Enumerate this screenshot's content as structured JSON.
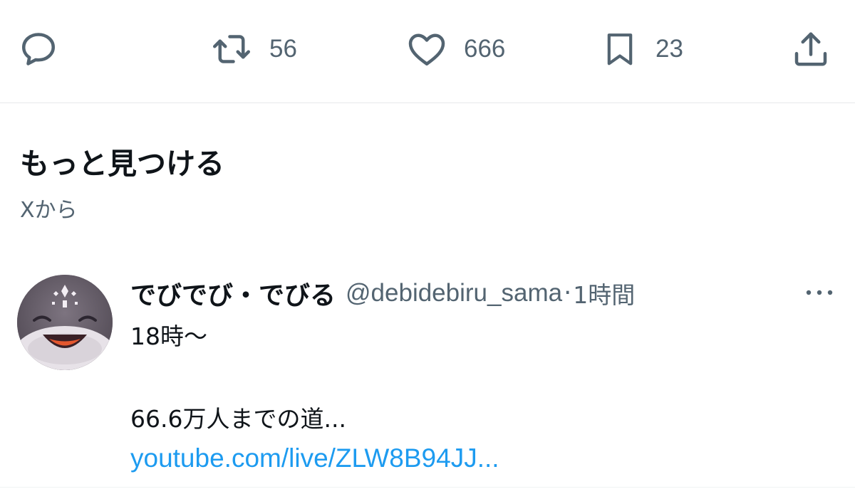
{
  "actions": {
    "reply": {
      "icon": "reply-icon"
    },
    "retweet": {
      "icon": "retweet-icon",
      "count": "56"
    },
    "like": {
      "icon": "heart-icon",
      "count": "666"
    },
    "bookmark": {
      "icon": "bookmark-icon",
      "count": "23"
    },
    "share": {
      "icon": "share-icon"
    }
  },
  "discover": {
    "title": "もっと見つける",
    "subtitle": "Xから"
  },
  "tweet": {
    "author_name": "でびでび・でびる",
    "handle": "@debidebiru_sama",
    "separator": "·",
    "time": "1時間",
    "lines": [
      "18時〜",
      "66.6万人までの道..."
    ],
    "link": "youtube.com/live/ZLW8B94JJ..."
  },
  "colors": {
    "text_primary": "#0f1419",
    "text_secondary": "#536471",
    "link": "#1d9bf0",
    "divider": "#e6e9eb"
  }
}
